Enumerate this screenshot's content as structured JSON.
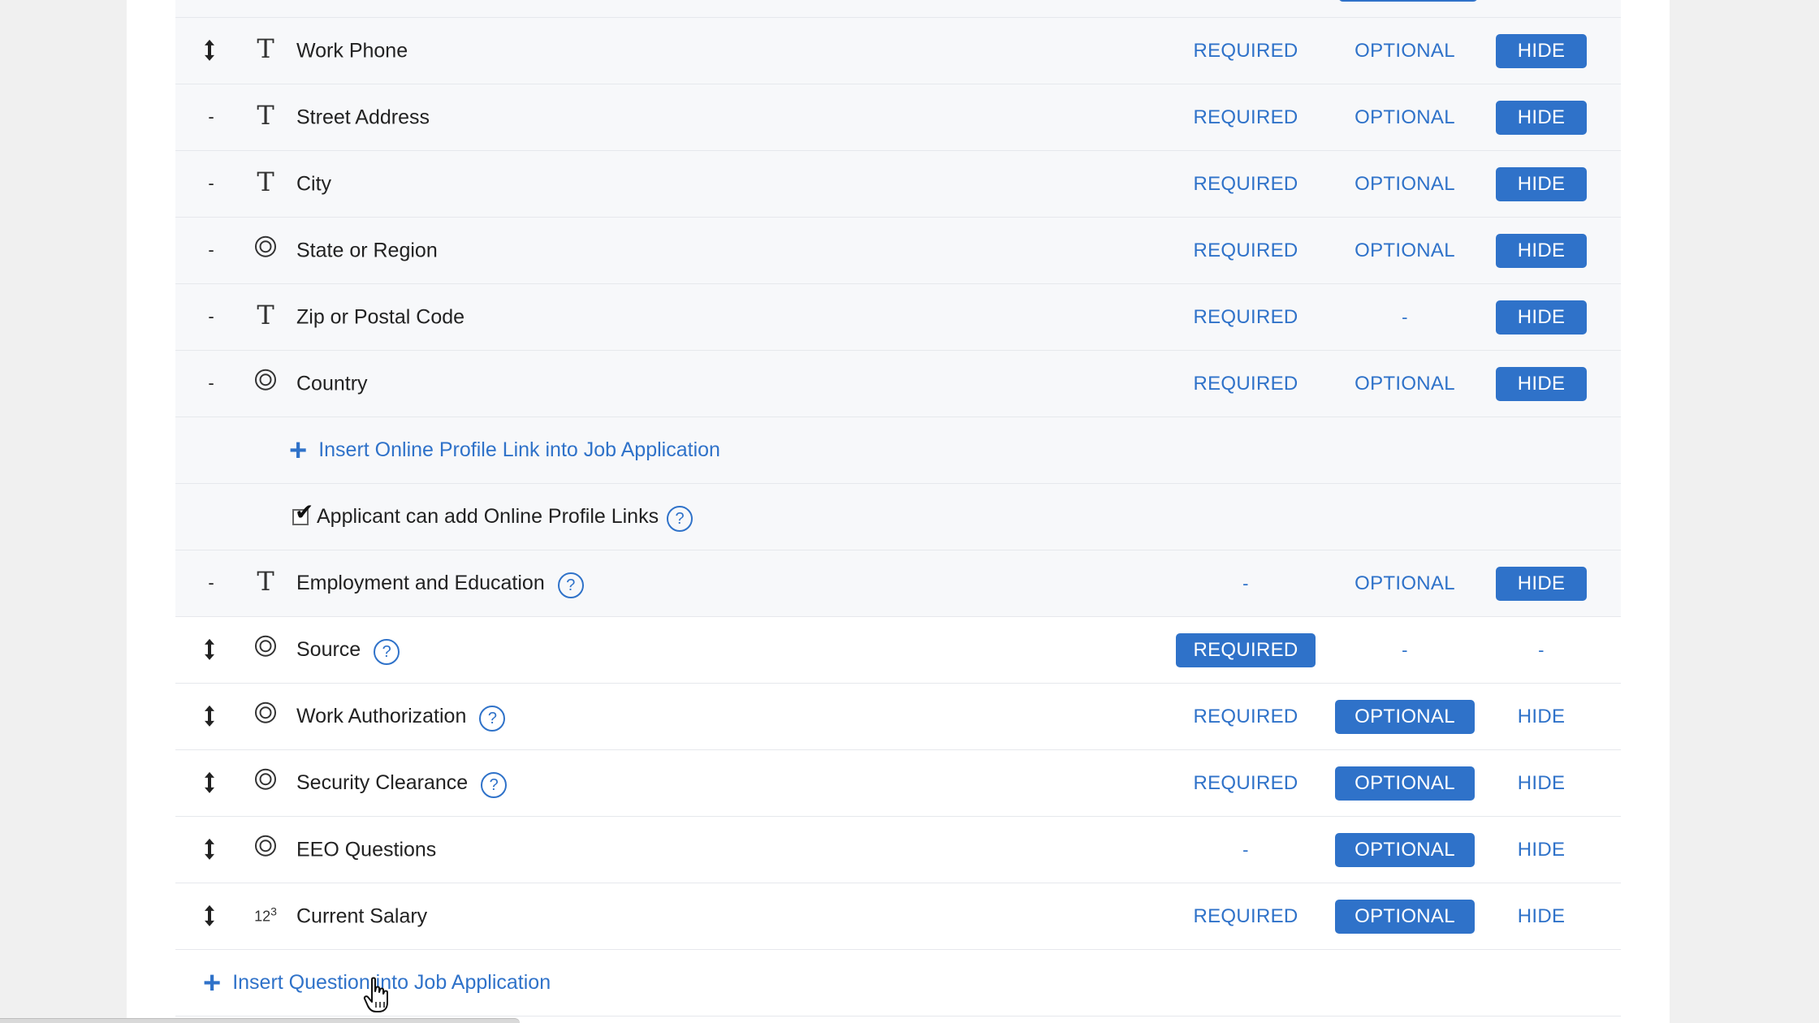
{
  "rows": [
    {
      "handle": "move",
      "type": "T",
      "label": "Work Phone",
      "required": "REQUIRED",
      "optional": "OPTIONAL",
      "hide": "HIDE",
      "active": "hide"
    },
    {
      "handle": "-",
      "type": "T",
      "label": "Street Address",
      "required": "REQUIRED",
      "optional": "OPTIONAL",
      "hide": "HIDE",
      "active": "hide"
    },
    {
      "handle": "-",
      "type": "T",
      "label": "City",
      "required": "REQUIRED",
      "optional": "OPTIONAL",
      "hide": "HIDE",
      "active": "hide"
    },
    {
      "handle": "-",
      "type": "choice",
      "label": "State or Region",
      "required": "REQUIRED",
      "optional": "OPTIONAL",
      "hide": "HIDE",
      "active": "hide"
    },
    {
      "handle": "-",
      "type": "T",
      "label": "Zip or Postal Code",
      "required": "REQUIRED",
      "optional": "-",
      "hide": "HIDE",
      "active": "hide"
    },
    {
      "handle": "-",
      "type": "choice",
      "label": "Country",
      "required": "REQUIRED",
      "optional": "OPTIONAL",
      "hide": "HIDE",
      "active": "hide"
    }
  ],
  "profile": {
    "insert_label": "Insert Online Profile Link into Job Application",
    "checkbox_label": "Applicant can add Online Profile Links",
    "checkbox_checked": true,
    "help": "?"
  },
  "rows2": [
    {
      "handle": "-",
      "type": "T",
      "label": "Employment and Education",
      "help": "?",
      "required": "-",
      "optional": "OPTIONAL",
      "hide": "HIDE",
      "active": "hide"
    },
    {
      "handle": "move",
      "type": "choice",
      "label": "Source",
      "help": "?",
      "required": "REQUIRED",
      "optional": "-",
      "hide": "-",
      "active": "required"
    },
    {
      "handle": "move",
      "type": "choice",
      "label": "Work Authorization",
      "help": "?",
      "required": "REQUIRED",
      "optional": "OPTIONAL",
      "hide": "HIDE",
      "active": "optional"
    },
    {
      "handle": "move",
      "type": "choice",
      "label": "Security Clearance",
      "help": "?",
      "required": "REQUIRED",
      "optional": "OPTIONAL",
      "hide": "HIDE",
      "active": "optional"
    },
    {
      "handle": "move",
      "type": "choice",
      "label": "EEO Questions",
      "required": "-",
      "optional": "OPTIONAL",
      "hide": "HIDE",
      "active": "optional"
    },
    {
      "handle": "move",
      "type": "number",
      "type_glyph": "123",
      "label": "Current Salary",
      "required": "REQUIRED",
      "optional": "OPTIONAL",
      "hide": "HIDE",
      "active": "optional"
    }
  ],
  "footer": {
    "insert_question_label": "Insert Question into Job Application"
  },
  "colors": {
    "accent": "#2f72c9",
    "row_shaded": "#f7f8fa",
    "page_bg": "#f0f0f0"
  },
  "icons": {
    "move": "up-down-arrow-icon",
    "T": "text-field-icon",
    "choice": "radio-choice-icon",
    "number": "number-field-icon",
    "plus": "plus-icon",
    "help": "help-circle-icon"
  }
}
